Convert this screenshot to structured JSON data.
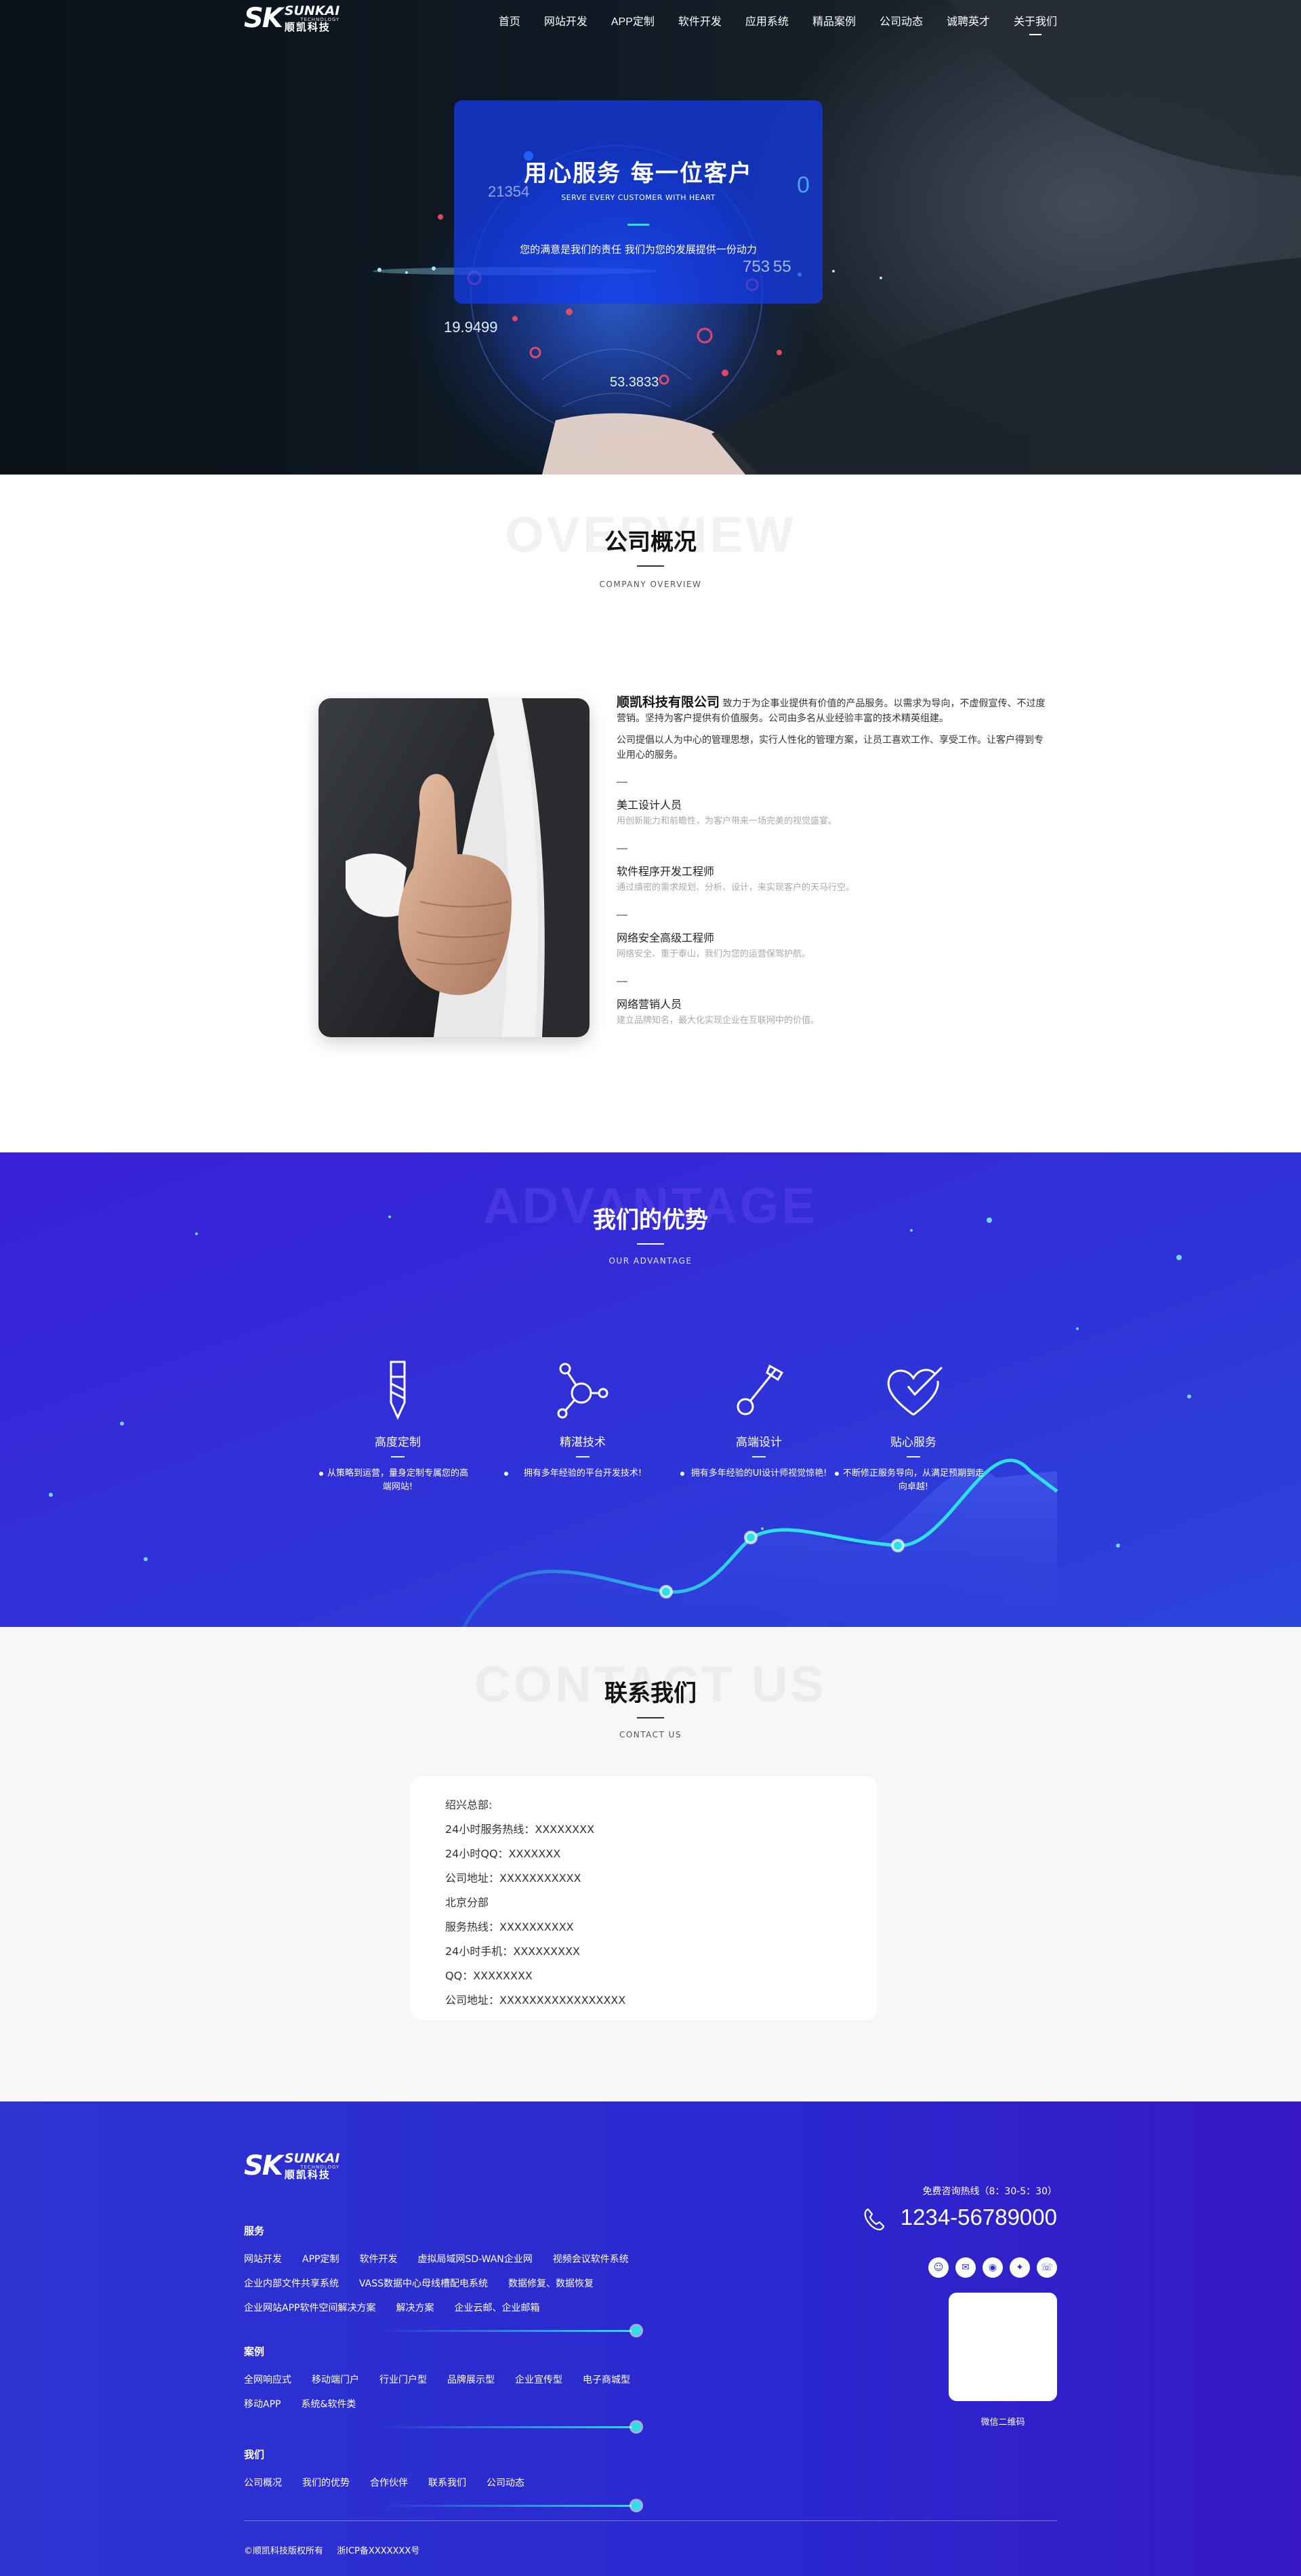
{
  "brand": {
    "logo_mark": "SK",
    "logo_en": "SUNKAI",
    "logo_sub": "TECHNOLOGY",
    "logo_cn": "顺凯科技"
  },
  "nav": [
    {
      "label": "首页"
    },
    {
      "label": "网站开发"
    },
    {
      "label": "APP定制"
    },
    {
      "label": "软件开发"
    },
    {
      "label": "应用系统"
    },
    {
      "label": "精品案例"
    },
    {
      "label": "公司动态"
    },
    {
      "label": "诚聘英才"
    },
    {
      "label": "关于我们"
    }
  ],
  "hero": {
    "title": "用心服务 每一位客户",
    "subtitle": "SERVE EVERY CUSTOMER WITH HEART",
    "description": "您的满意是我们的责任 我们为您的发展提供一份动力",
    "numbers": [
      "21354",
      "753 55",
      "19.9499",
      "53.3833",
      "0"
    ]
  },
  "overview": {
    "bg_text": "OVERVIEW",
    "title": "公司概况",
    "subtitle": "COMPANY OVERVIEW",
    "company": "顺凯科技有限公司",
    "intro": "致力于为企事业提供有价值的产品服务。以需求为导向，不虚假宣传、不过度营销。坚持为客户提供有价值服务。公司由多名从业经验丰富的技术精英组建。",
    "intro2": "公司提倡以人为中心的管理思想，实行人性化的管理方案，让员工喜欢工作、享受工作。让客户得到专业用心的服务。",
    "items": [
      {
        "title": "美工设计人员",
        "desc": "用创新能力和前瞻性，为客户带来一场完美的视觉盛宴。"
      },
      {
        "title": "软件程序开发工程师",
        "desc": "通过缜密的需求规划、分析、设计，来实现客户的天马行空。"
      },
      {
        "title": "网络安全高级工程师",
        "desc": "网络安全、重于泰山，我们为您的运营保驾护航。"
      },
      {
        "title": "网络营销人员",
        "desc": "建立品牌知名，最大化实现企业在互联网中的价值。"
      }
    ]
  },
  "advantage": {
    "bg_text": "ADVANTAGE",
    "title": "我们的优势",
    "subtitle": "OUR ADVANTAGE",
    "items": [
      {
        "title": "高度定制",
        "desc": "从策略到运营，量身定制专属您的高端网站!"
      },
      {
        "title": "精湛技术",
        "desc": "拥有多年经验的平台开发技术!"
      },
      {
        "title": "高端设计",
        "desc": "拥有多年经验的UI设计师视觉惊艳!"
      },
      {
        "title": "贴心服务",
        "desc": "不断修正服务导向，从满足预期到走向卓越!"
      }
    ]
  },
  "contact": {
    "bg_text": "CONTACT US",
    "title": "联系我们",
    "subtitle": "CONTACT US",
    "lines": [
      "绍兴总部:",
      "24小时服务热线：XXXXXXXX",
      "24小时QQ：XXXXXXX",
      "公司地址：XXXXXXXXXXX",
      "北京分部",
      "服务热线：XXXXXXXXXX",
      "24小时手机：XXXXXXXXX",
      "QQ：XXXXXXXX",
      "公司地址：XXXXXXXXXXXXXXXXX"
    ]
  },
  "footer": {
    "groups": [
      {
        "title": "服务",
        "links": [
          "网站开发",
          "APP定制",
          "软件开发",
          "虚拟局域网SD-WAN企业网",
          "视频会议软件系统",
          "企业内部文件共享系统",
          "VASS数据中心母线槽配电系统",
          "数据修复、数据恢复",
          "企业网站APP软件空间解决方案",
          "解决方案",
          "企业云邮、企业邮箱"
        ]
      },
      {
        "title": "案例",
        "links": [
          "全网响应式",
          "移动端门户",
          "行业门户型",
          "品牌展示型",
          "企业宣传型",
          "电子商城型",
          "移动APP",
          "系统&软件类"
        ]
      },
      {
        "title": "我们",
        "links": [
          "公司概况",
          "我们的优势",
          "合作伙伴",
          "联系我们",
          "公司动态"
        ]
      }
    ],
    "hotline_label": "免费咨询热线（8：30-5：30）",
    "phone": "1234-56789000",
    "qr_label": "微信二维码",
    "copyright": "©顺凯科技版权所有",
    "icp": "浙ICP备XXXXXXX号"
  },
  "colors": {
    "accent_cyan": "#2ee0e6",
    "brand_blue": "#2e32d0",
    "advantage_purple": "#3a1fd6"
  }
}
